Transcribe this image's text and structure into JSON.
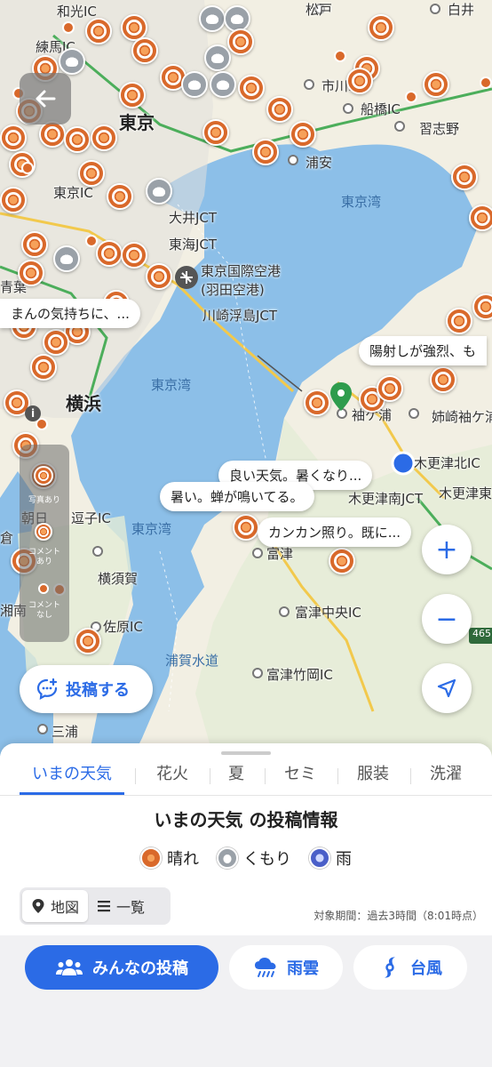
{
  "map": {
    "place_labels": [
      "和光IC",
      "練馬IC",
      "東京",
      "松戸",
      "白井",
      "市川IC",
      "船橋IC",
      "習志野",
      "浦安",
      "東京湾",
      "東京IC",
      "大井JCT",
      "東海JCT",
      "東京国際空港",
      "(羽田空港)",
      "川崎浮島JCT",
      "横浜",
      "東京湾",
      "袖ケ浦",
      "姉崎袖ケ浦",
      "木更津北IC",
      "木更津南JCT",
      "木更津東",
      "東京湾",
      "富津",
      "逗子IC",
      "横須賀",
      "佐原IC",
      "富津中央IC",
      "浦賀水道",
      "富津竹岡IC",
      "三浦",
      "青葉",
      "朝日",
      "倉",
      "湘南"
    ],
    "bubbles": [
      "まんの気持ちに、...",
      "陽射しが強烈、も",
      "良い天気。暑くなり...",
      "暑い。蝉が鳴いてる。",
      "カンカン照り。既に..."
    ],
    "legend_strip": {
      "photo": "写真あり",
      "comment": "コメントあり",
      "no_comment": "コメントなし"
    },
    "road_badge": "465"
  },
  "actions": {
    "post_label": "投稿する",
    "zoom_in": "+",
    "zoom_out": "−"
  },
  "sheet": {
    "tabs": [
      "いまの天気",
      "花火",
      "夏",
      "セミ",
      "服装",
      "洗濯"
    ],
    "active_tab": 0,
    "title": "いまの天気 の投稿情報",
    "legend": [
      {
        "label": "晴れ",
        "color": "#d9692b"
      },
      {
        "label": "くもり",
        "color": "#9aa1a8"
      },
      {
        "label": "雨",
        "color": "#4a5fc8"
      }
    ],
    "view_toggle": {
      "map": "地図",
      "list": "一覧"
    },
    "period": "対象期間：過去3時間（8:01時点）"
  },
  "bottom_nav": {
    "community": "みんなの投稿",
    "rain_cloud": "雨雲",
    "typhoon": "台風"
  },
  "colors": {
    "accent": "#2b6be6",
    "sunny": "#d9692b",
    "cloudy": "#9aa1a8",
    "sea": "#8cbfe8",
    "land": "#f2efe3"
  }
}
